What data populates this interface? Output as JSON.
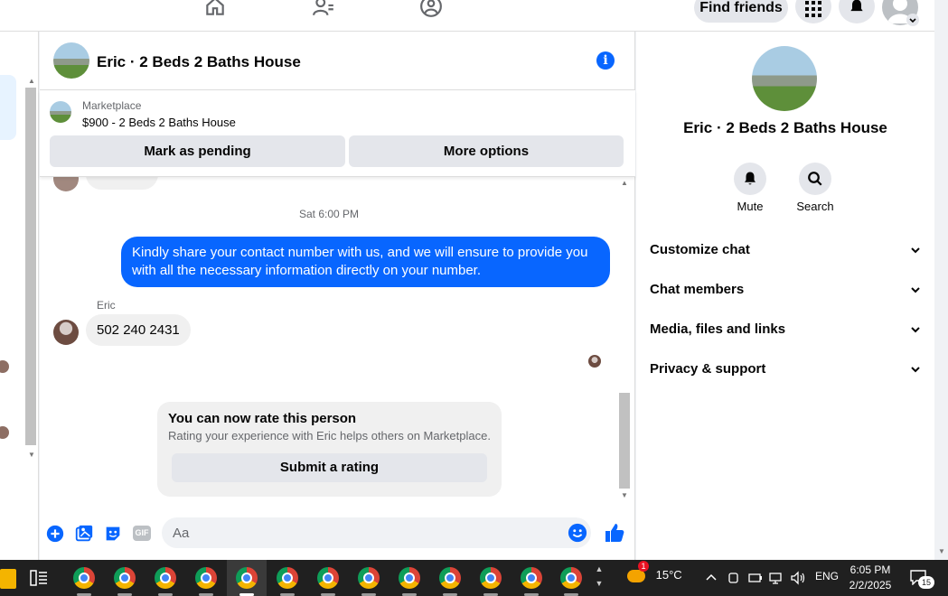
{
  "topnav": {
    "find_friends_label": "Find friends"
  },
  "chat": {
    "title": "Eric · 2 Beds 2 Baths House",
    "listing": {
      "label": "Marketplace",
      "price_title": "$900 - 2 Beds 2 Baths House",
      "mark_pending": "Mark as pending",
      "more_options": "More options"
    },
    "messages": {
      "timestamp": "Sat 6:00 PM",
      "outgoing": "Kindly share your contact number with us, and we will ensure to provide you with all the necessary information directly on your number.",
      "sender_name": "Eric",
      "incoming": "502 240 2431"
    },
    "rating": {
      "title": "You can now rate this person",
      "subtitle": "Rating your experience with Eric helps others on Marketplace.",
      "button": "Submit a rating"
    },
    "composer": {
      "placeholder": "Aa"
    }
  },
  "right_panel": {
    "title": "Eric · 2 Beds 2 Baths House",
    "mute_label": "Mute",
    "search_label": "Search",
    "sections": [
      "Customize chat",
      "Chat members",
      "Media, files and links",
      "Privacy & support"
    ]
  },
  "taskbar": {
    "weather": "15°C",
    "weather_badge": "1",
    "language": "ENG",
    "time": "6:05 PM",
    "date": "2/2/2025",
    "notifications": "15"
  },
  "colors": {
    "accent": "#0866ff",
    "bubble_in": "#f0f0f0",
    "button_gray": "#e4e6eb"
  }
}
